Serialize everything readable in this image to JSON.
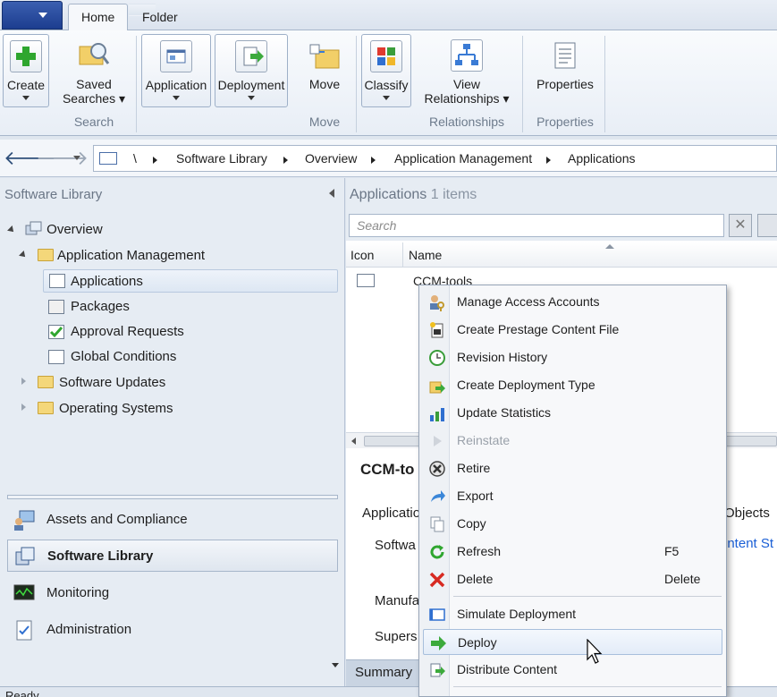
{
  "ribbon": {
    "tabs": [
      "Home",
      "Folder"
    ],
    "buttons": {
      "create": "Create",
      "saved_searches_1": "Saved",
      "saved_searches_2": "Searches",
      "application": "Application",
      "deployment": "Deployment",
      "move": "Move",
      "classify": "Classify",
      "view_relationships_1": "View",
      "view_relationships_2": "Relationships",
      "properties": "Properties"
    },
    "groups": {
      "search": "Search",
      "move": "Move",
      "relationships": "Relationships",
      "properties": "Properties"
    }
  },
  "address": {
    "root": "\\",
    "crumbs": [
      "Software Library",
      "Overview",
      "Application Management",
      "Applications"
    ]
  },
  "left_pane": {
    "title": "Software Library",
    "tree": {
      "overview": "Overview",
      "app_mgmt": "Application Management",
      "applications": "Applications",
      "packages": "Packages",
      "approval": "Approval Requests",
      "global_conditions": "Global Conditions",
      "software_updates": "Software Updates",
      "operating_systems": "Operating Systems"
    },
    "workspaces": {
      "assets": "Assets and Compliance",
      "software_library": "Software Library",
      "monitoring": "Monitoring",
      "administration": "Administration"
    }
  },
  "right_pane": {
    "title": "Applications",
    "count": "1 items",
    "search_placeholder": "Search",
    "columns": {
      "icon": "Icon",
      "name": "Name"
    },
    "row_name": "CCM-tools",
    "details_title": "CCM-to",
    "details": {
      "application": "Applicatio",
      "objects": "Objects",
      "software": "Softwa",
      "content_status": "ontent St",
      "manufacturer": "Manufa",
      "supersedence": "Supers"
    },
    "summary_tab": "Summary"
  },
  "status": {
    "text": "Ready"
  },
  "context_menu": {
    "items": [
      {
        "label": "Manage Access Accounts",
        "key": ""
      },
      {
        "label": "Create Prestage Content File",
        "key": ""
      },
      {
        "label": "Revision History",
        "key": ""
      },
      {
        "label": "Create Deployment Type",
        "key": ""
      },
      {
        "label": "Update Statistics",
        "key": ""
      },
      {
        "label": "Reinstate",
        "key": ""
      },
      {
        "label": "Retire",
        "key": ""
      },
      {
        "label": "Export",
        "key": ""
      },
      {
        "label": "Copy",
        "key": ""
      },
      {
        "label": "Refresh",
        "key": "F5"
      },
      {
        "label": "Delete",
        "key": "Delete"
      },
      {
        "label": "Simulate Deployment",
        "key": ""
      },
      {
        "label": "Deploy",
        "key": ""
      },
      {
        "label": "Distribute Content",
        "key": ""
      }
    ]
  },
  "colors": {
    "accent": "#3b5fb0",
    "selection": "#dde7f3",
    "link": "#1a5fd6"
  }
}
